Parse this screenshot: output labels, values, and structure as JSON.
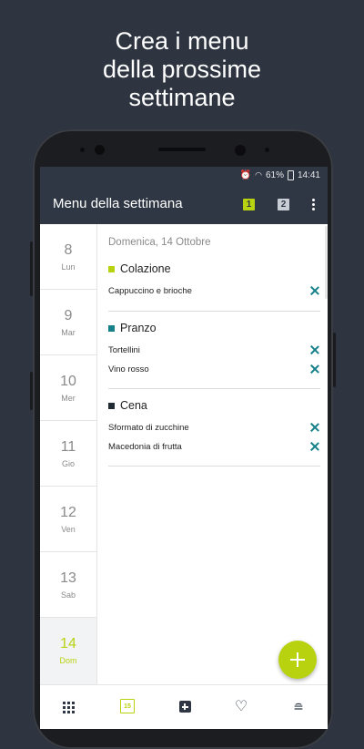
{
  "promo": {
    "headline_line1": "Crea i menu",
    "headline_line2": "della prossime",
    "headline_line3": "settimane"
  },
  "status_bar": {
    "battery": "61%",
    "time": "14:41"
  },
  "app_bar": {
    "title": "Menu della settimana",
    "week1_label": "1",
    "week2_label": "2"
  },
  "days": [
    {
      "num": "8",
      "weekday": "Lun"
    },
    {
      "num": "9",
      "weekday": "Mar"
    },
    {
      "num": "10",
      "weekday": "Mer"
    },
    {
      "num": "11",
      "weekday": "Gio"
    },
    {
      "num": "12",
      "weekday": "Ven"
    },
    {
      "num": "13",
      "weekday": "Sab"
    },
    {
      "num": "14",
      "weekday": "Dom"
    }
  ],
  "content": {
    "date": "Domenica, 14 Ottobre",
    "meals": [
      {
        "name": "Colazione",
        "color": "#b9d20f",
        "items": [
          "Cappuccino e brioche"
        ]
      },
      {
        "name": "Pranzo",
        "color": "#17818a",
        "items": [
          "Tortellini",
          "Vino rosso"
        ]
      },
      {
        "name": "Cena",
        "color": "#1f2a33",
        "items": [
          "Sformato di zucchine",
          "Macedonia di frutta"
        ]
      }
    ]
  },
  "bottom_nav": {
    "calendar_day": "15"
  },
  "colors": {
    "accent": "#b9d20f",
    "toolbar": "#2f3745",
    "delete": "#17818a"
  }
}
